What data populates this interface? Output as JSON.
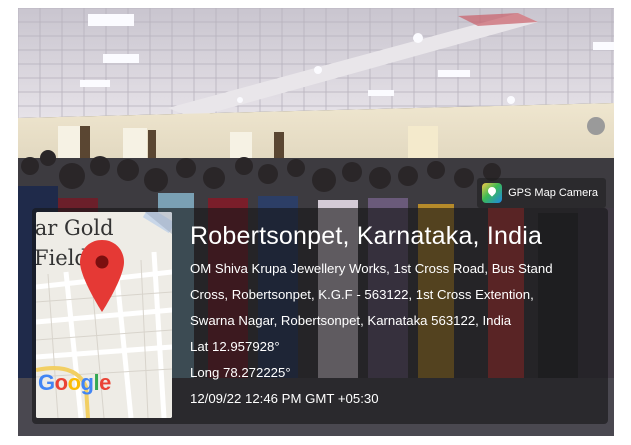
{
  "badge": {
    "app_name": "GPS Map Camera",
    "icon": "gps-map-camera-icon"
  },
  "map": {
    "place_line_1": "lar Gold",
    "place_line_2": "Fields",
    "brand": "Google",
    "brand_letters": [
      "G",
      "o",
      "o",
      "g",
      "l",
      "e"
    ],
    "pin_icon": "location-pin-icon",
    "pin_color": "#e53935"
  },
  "location": {
    "title": "Robertsonpet, Karnataka, India",
    "address_lines": [
      "OM Shiva Krupa Jewellery Works, 1st Cross Road, Bus Stand",
      "Cross, Robertsonpet, K.G.F - 563122, 1st Cross Extention,",
      "Swarna Nagar, Robertsonpet, Karnataka 563122, India"
    ],
    "lat": "Lat 12.957928°",
    "long": "Long 78.272225°",
    "datetime": "12/09/22 12:46 PM GMT +05:30"
  },
  "colors": {
    "google_blue": "#4285F4",
    "google_red": "#EA4335",
    "google_yellow": "#FBBC05",
    "google_green": "#34A853"
  }
}
